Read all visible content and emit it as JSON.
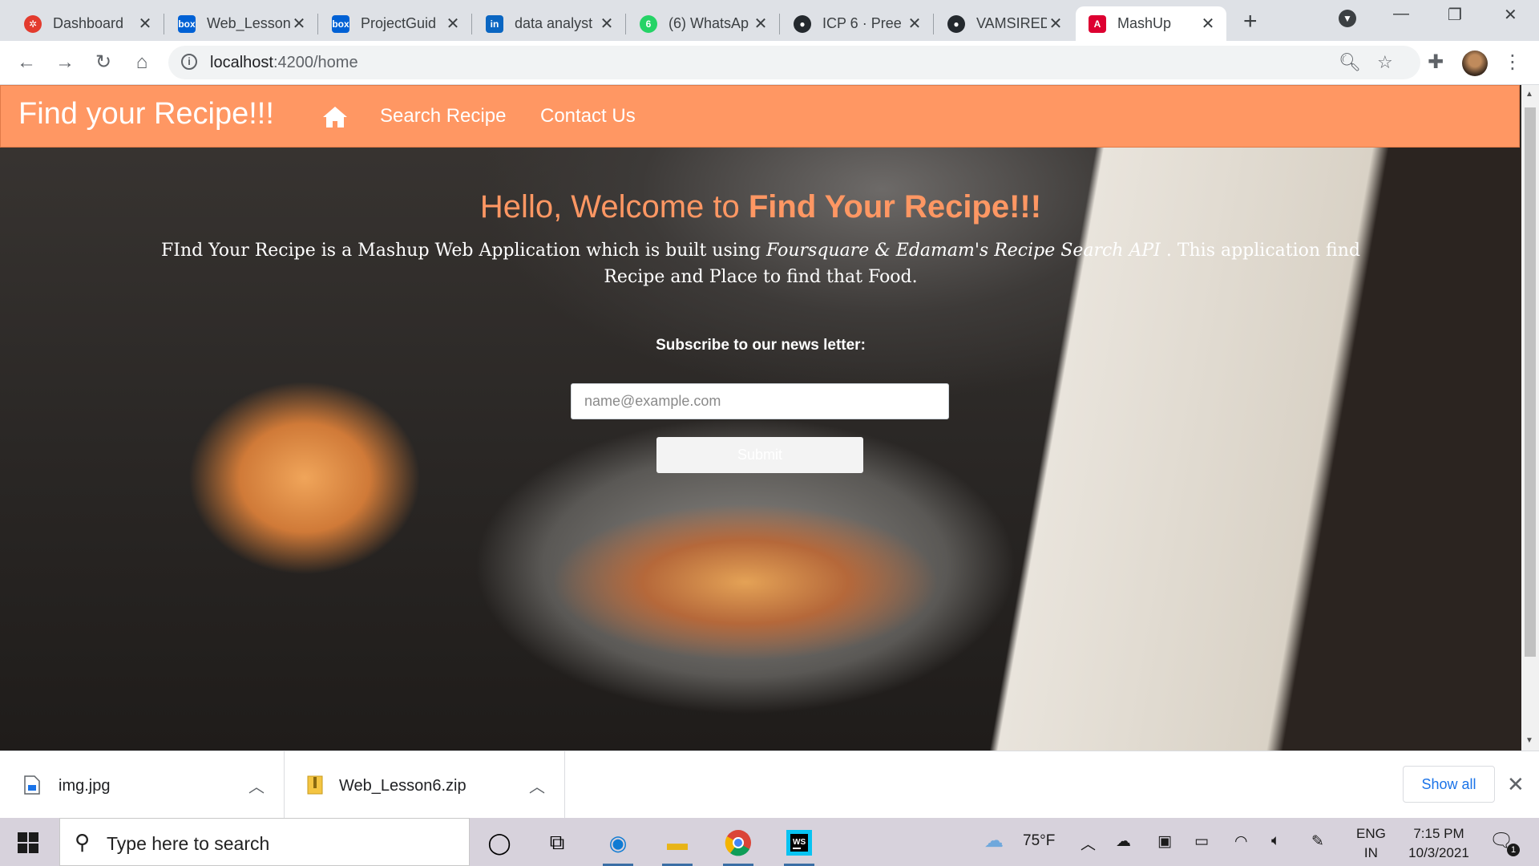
{
  "browser": {
    "tabs": [
      {
        "title": "Dashboard",
        "favicon": "canvas-icon",
        "color": "#e33b2e"
      },
      {
        "title": "Web_Lesson",
        "favicon": "box-icon",
        "color": "#0061d5"
      },
      {
        "title": "ProjectGuid",
        "favicon": "box-icon",
        "color": "#0061d5"
      },
      {
        "title": "data analyst",
        "favicon": "linkedin-icon",
        "color": "#0a66c2"
      },
      {
        "title": "(6) WhatsAp",
        "favicon": "whatsapp-icon",
        "color": "#25d366"
      },
      {
        "title": "ICP 6 · Pree",
        "favicon": "github-icon",
        "color": "#24292e"
      },
      {
        "title": "VAMSIREDI",
        "favicon": "github-icon",
        "color": "#24292e"
      },
      {
        "title": "MashUp",
        "favicon": "angular-icon",
        "color": "#dd0031",
        "active": true
      }
    ],
    "favicon_text": {
      "box": "box",
      "linkedin": "in",
      "whatsapp": "6"
    },
    "url_host": "localhost",
    "url_path": ":4200/home"
  },
  "navbar": {
    "brand": "Find your Recipe!!!",
    "links": [
      "Search Recipe",
      "Contact Us"
    ]
  },
  "hero": {
    "welcome_prefix": "Hello, Welcome to ",
    "welcome_bold": "Find Your Recipe!!!",
    "desc_part1": "FInd Your Recipe is a Mashup Web Application which is built using ",
    "desc_italic": "Foursquare & Edamam's Recipe Search API",
    "desc_part2": " . This application find Recipe and Place to find that Food.",
    "subscribe": "Subscribe to our news letter:",
    "email_placeholder": "name@example.com",
    "submit": "Submit"
  },
  "downloads": {
    "items": [
      "img.jpg",
      "Web_Lesson6.zip"
    ],
    "show_all": "Show all"
  },
  "taskbar": {
    "search_placeholder": "Type here to search",
    "weather": "75°F",
    "lang_top": "ENG",
    "lang_bottom": "IN",
    "time": "7:15 PM",
    "date": "10/3/2021",
    "notification_count": "1"
  },
  "colors": {
    "accent": "#ff9763",
    "link": "#1a73e8"
  }
}
